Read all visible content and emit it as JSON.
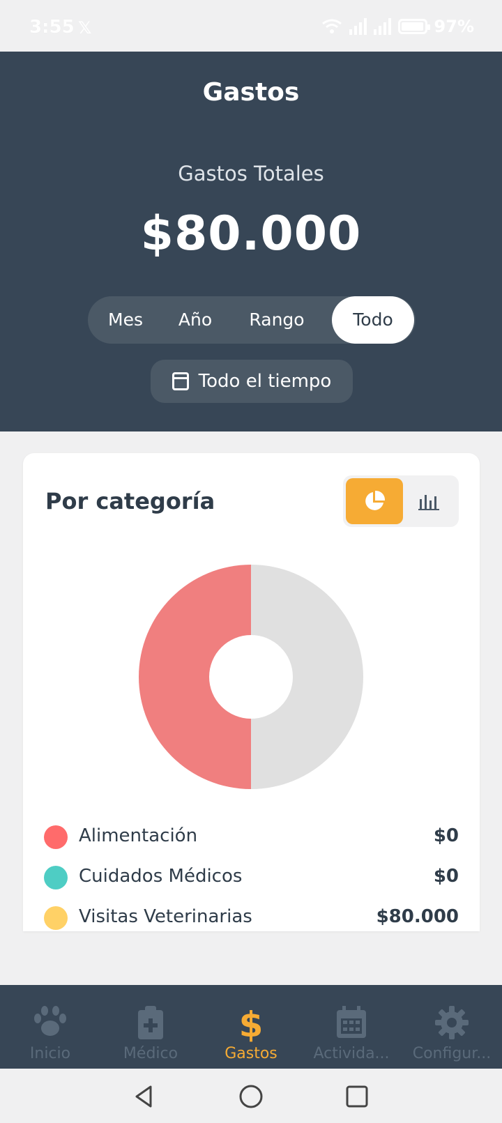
{
  "status": {
    "time": "3:55",
    "battery": "97%"
  },
  "header": {
    "title": "Gastos",
    "subtitle": "Gastos Totales",
    "total": "$80.000",
    "periods": [
      "Mes",
      "Año",
      "Rango",
      "Todo"
    ],
    "selected_period": "Todo",
    "range_label": "Todo el tiempo"
  },
  "card": {
    "title": "Por categoría",
    "view_mode": "pie"
  },
  "chart_data": {
    "type": "pie",
    "slices": [
      {
        "name": "Alimentación",
        "value": 0,
        "color": "#f07f7f"
      },
      {
        "name": "Cuidados Médicos",
        "value": 0,
        "color": "#4ecdc4"
      },
      {
        "name": "Visitas Veterinarias",
        "value": 80000,
        "color": "#ffd166"
      }
    ],
    "rendered_fill": 0.5,
    "rendered_colors": [
      "#f07f7f",
      "#e0e0e0"
    ]
  },
  "legend": [
    {
      "label": "Alimentación",
      "value": "$0",
      "color": "#ff6b6b"
    },
    {
      "label": "Cuidados Médicos",
      "value": "$0",
      "color": "#4ecdc4"
    },
    {
      "label": "Visitas Veterinarias",
      "value": "$80.000",
      "color": "#ffd166"
    }
  ],
  "tabs": [
    {
      "label": "Inicio",
      "icon": "paw-icon"
    },
    {
      "label": "Médico",
      "icon": "medical-clipboard-icon"
    },
    {
      "label": "Gastos",
      "icon": "dollar-icon",
      "active": true
    },
    {
      "label": "Activida...",
      "icon": "calendar-icon"
    },
    {
      "label": "Configur...",
      "icon": "gear-icon"
    }
  ],
  "colors": {
    "header_bg": "#374656",
    "accent": "#f6ab34",
    "text_dark": "#2f3c49"
  }
}
